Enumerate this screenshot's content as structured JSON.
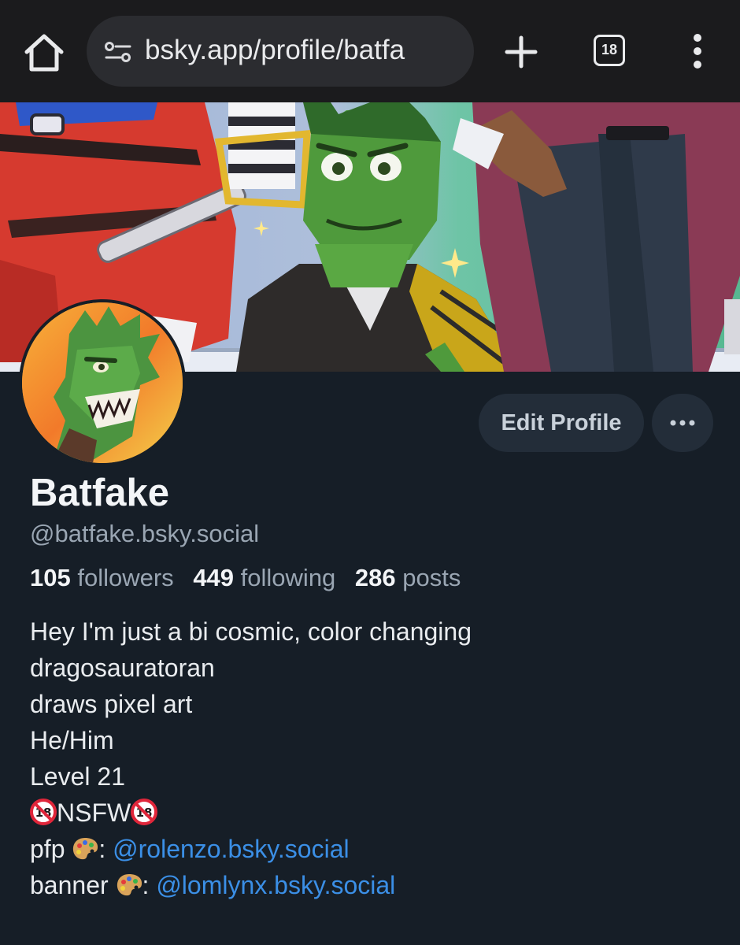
{
  "browser": {
    "url": "bsky.app/profile/batfa",
    "tab_count": "18"
  },
  "profile": {
    "display_name": "Batfake",
    "handle": "@batfake.bsky.social",
    "edit_button_label": "Edit Profile",
    "stats": [
      {
        "value": "105",
        "label": "followers"
      },
      {
        "value": "449",
        "label": "following"
      },
      {
        "value": "286",
        "label": "posts"
      }
    ]
  },
  "bio": {
    "line1": "Hey I'm just a bi cosmic, color changing",
    "line2": "dragosauratoran",
    "line3": "draws pixel art",
    "line4": "He/Him",
    "line5": "Level 21",
    "nsfw_text": "NSFW",
    "pfp_label": "pfp",
    "pfp_link": "@rolenzo.bsky.social",
    "banner_label": "banner",
    "banner_link": "@lomlynx.bsky.social",
    "credit_separator": ":",
    "icons": {
      "home": "home-icon",
      "site_info": "tune-icon",
      "new_tab": "plus-icon",
      "menu": "kebab-menu-icon",
      "more": "ellipsis-icon",
      "no_under_18": "no-under-18-icon",
      "palette": "artist-palette-icon"
    }
  },
  "colors": {
    "page_bg": "#161e27",
    "link": "#3b8fe6",
    "muted_text": "#9aa6b3",
    "button_bg": "#232d39"
  }
}
